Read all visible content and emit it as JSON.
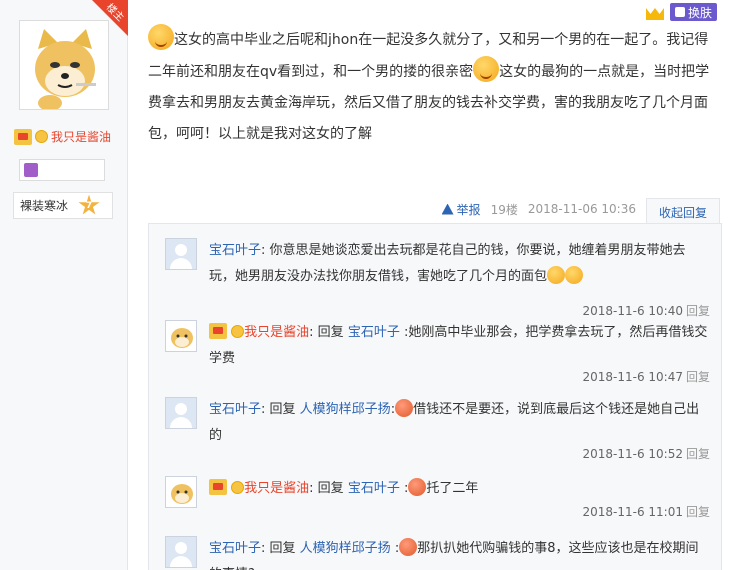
{
  "sidebar": {
    "corner_badge": "楼主",
    "username": "我只是酱油",
    "level_name": "裸装寒冰",
    "level_num": "7"
  },
  "topbar": {
    "skin_label": "换肤"
  },
  "post": {
    "text1": "这女的高中毕业之后呢和jhon在一起没多久就分了，又和另一个男的在一起了。我记得二年前还和朋友在qv看到过，和一个男的搂的很亲密",
    "text2": "这女的最狗的一点就是，当时把学费拿去和男朋友去黄金海岸玩，然后又借了朋友的钱去补交学费，害的我朋友吃了几个月面包，呵呵！以上就是我对这女的了解",
    "report": "举报",
    "floor": "19楼",
    "time": "2018-11-06 10:36",
    "collapse": "收起回复"
  },
  "replies": [
    {
      "user": "宝石叶子",
      "text": ": 你意思是她谈恋爱出去玩都是花自己的钱，你要说，她缠着男朋友带她去玩，她男朋友没办法找你朋友借钱，害她吃了几个月的面包",
      "time": "2018-11-6 10:40",
      "reply_label": "回复"
    },
    {
      "user": "我只是酱油",
      "mid": ": 回复 ",
      "target": "宝石叶子",
      "text": " :她刚高中毕业那会，把学费拿去玩了，然后再借钱交学费",
      "time": "2018-11-6 10:47",
      "reply_label": "回复"
    },
    {
      "user": "宝石叶子",
      "mid": ": 回复 ",
      "target": "人模狗样邱子扬",
      "text": "借钱还不是要还，说到底最后这个钱还是她自己出的",
      "time": "2018-11-6 10:52",
      "reply_label": "回复"
    },
    {
      "user": "我只是酱油",
      "mid": ": 回复 ",
      "target": "宝石叶子",
      "text": "托了二年",
      "time": "2018-11-6 11:01",
      "reply_label": "回复"
    },
    {
      "user": "宝石叶子",
      "mid": ": 回复 ",
      "target": "人模狗样邱子扬",
      "text": "那扒扒她代购骗钱的事8，这些应该也是在校期间的事情?"
    }
  ]
}
